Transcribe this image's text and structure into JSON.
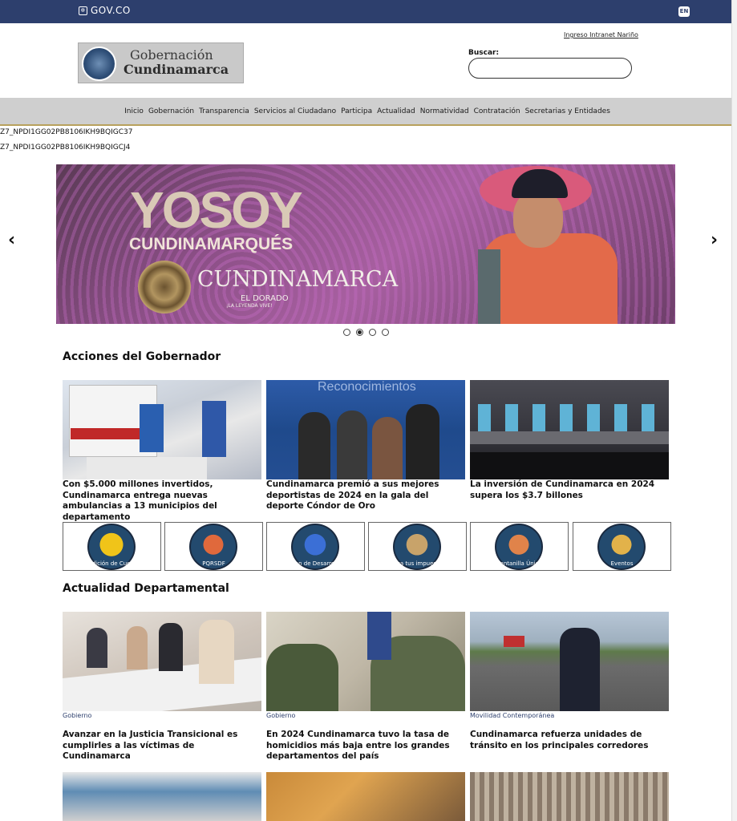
{
  "topbar": {
    "govco": "GOV.CO",
    "lang": "EN"
  },
  "header": {
    "intranet_link": "Ingreso Intranet Nariño",
    "logo_line1": "Gobernación",
    "logo_line2": "Cundinamarca",
    "search_label": "Buscar:",
    "search_placeholder": ""
  },
  "nav": {
    "items": [
      "Inicio",
      "Gobernación",
      "Transparencia",
      "Servicios al Ciudadano",
      "Participa",
      "Actualidad",
      "Normatividad",
      "Contratación",
      "Secretarias y Entidades"
    ]
  },
  "portlet_codes": [
    "Z7_NPDI1GG02PB8106IKH9BQIGC37",
    "Z7_NPDI1GG02PB8106IKH9BQIGCJ4"
  ],
  "banner": {
    "headline": "YOSOY",
    "subline": "CUNDINAMARQUÉS",
    "brand": "CUNDINAMARCA",
    "tagline": "EL DORADO",
    "tagline2": "¡LA LEYENDA VIVE!",
    "slide_count": 4,
    "active_slide": 2
  },
  "acciones": {
    "title": "Acciones del Gobernador",
    "cards": [
      {
        "title": "Con $5.000 millones invertidos, Cundinamarca entrega nuevas ambulancias a 13 municipios del departamento"
      },
      {
        "title": "Cundinamarca premió a sus mejores deportistas de 2024 en la gala del deporte Cóndor de Oro",
        "img_text": "Reconocimientos"
      },
      {
        "title": "La inversión de Cundinamarca en 2024 supera los $3.7 billones"
      }
    ]
  },
  "quick_links": [
    {
      "label": "Rendición de Cuentas",
      "color": "#f0c419"
    },
    {
      "label": "PQRSDF",
      "color": "#e0693c"
    },
    {
      "label": "Plan de Desarrollo",
      "color": "#3b6fd6"
    },
    {
      "label": "Paga tus impuestos",
      "color": "#c8a36a"
    },
    {
      "label": "Ventanilla Única",
      "color": "#e0834a"
    },
    {
      "label": "Eventos",
      "color": "#e2b24a"
    }
  ],
  "actualidad": {
    "title": "Actualidad Departamental",
    "cards": [
      {
        "category": "Gobierno",
        "title": "Avanzar en la Justicia Transicional es cumplirles a las víctimas de Cundinamarca"
      },
      {
        "category": "Gobierno",
        "title": "En 2024 Cundinamarca tuvo la tasa de homicidios más baja entre los grandes departamentos del país"
      },
      {
        "category": "Movilidad Contemporánea",
        "title": "Cundinamarca refuerza unidades de tránsito en los principales corredores"
      }
    ]
  }
}
